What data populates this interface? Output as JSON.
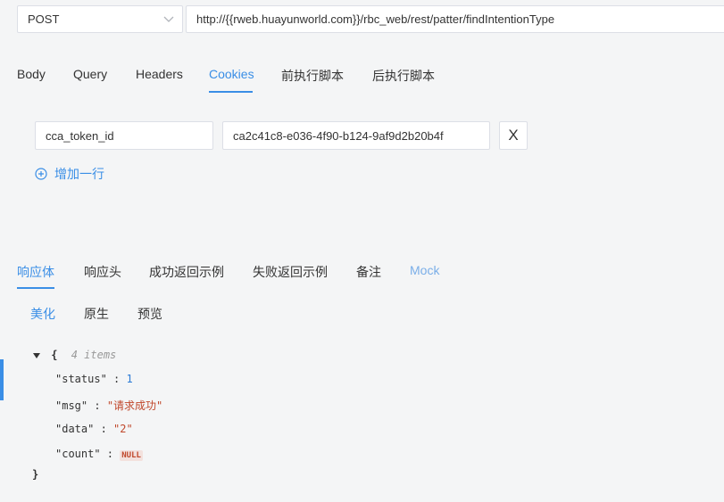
{
  "request": {
    "method": "POST",
    "url": "http://{{rweb.huayunworld.com}}/rbc_web/rest/patter/findIntentionType"
  },
  "request_tabs": [
    {
      "label": "Body"
    },
    {
      "label": "Query"
    },
    {
      "label": "Headers"
    },
    {
      "label": "Cookies",
      "active": true
    },
    {
      "label": "前执行脚本"
    },
    {
      "label": "后执行脚本"
    }
  ],
  "cookies": {
    "rows": [
      {
        "key": "cca_token_id",
        "value": "ca2c41c8-e036-4f90-b124-9af9d2b20b4f"
      }
    ],
    "delete_label": "X",
    "add_row_label": "增加一行"
  },
  "response_tabs": [
    {
      "label": "响应体",
      "active": true
    },
    {
      "label": "响应头"
    },
    {
      "label": "成功返回示例"
    },
    {
      "label": "失败返回示例"
    },
    {
      "label": "备注"
    },
    {
      "label": "Mock"
    }
  ],
  "view_tabs": [
    {
      "label": "美化",
      "active": true
    },
    {
      "label": "原生"
    },
    {
      "label": "预览"
    }
  ],
  "json_view": {
    "open_brace": "{",
    "items_count": "4 items",
    "close_brace": "}",
    "entries": [
      {
        "key": "\"status\"",
        "value": "1",
        "type": "num"
      },
      {
        "key": "\"msg\"",
        "value": "\"请求成功\"",
        "type": "str"
      },
      {
        "key": "\"data\"",
        "value": "\"2\"",
        "type": "str"
      },
      {
        "key": "\"count\"",
        "value": "NULL",
        "type": "null"
      }
    ]
  },
  "colors": {
    "accent": "#3a8ee6",
    "string": "#c0472b",
    "number": "#2b7bd6"
  }
}
